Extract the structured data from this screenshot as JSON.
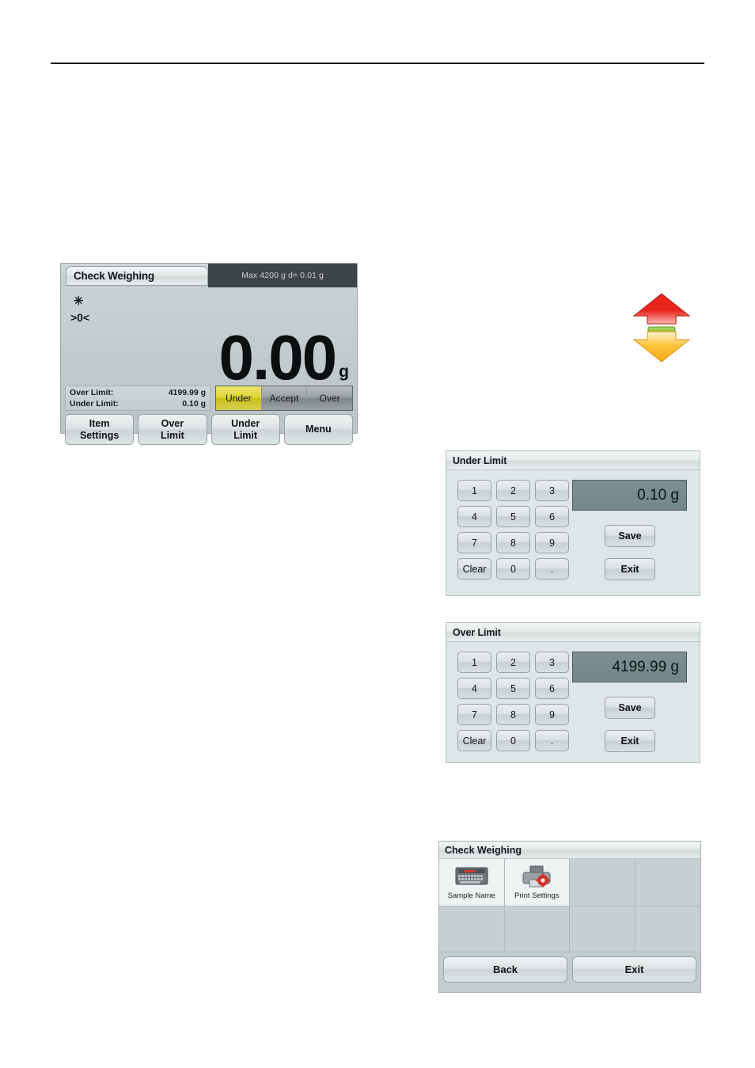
{
  "main_display": {
    "title": "Check Weighing",
    "capacity": "Max 4200 g   d= 0.01 g",
    "flag_stable": "✳",
    "flag_zero": ">0<",
    "weight_value": "0.00",
    "weight_unit": "g",
    "limits": [
      {
        "label": "Over Limit:",
        "value": "4199.99 g"
      },
      {
        "label": "Under Limit:",
        "value": "0.10 g"
      }
    ],
    "segments": [
      {
        "label": "Under",
        "state": "active"
      },
      {
        "label": "Accept",
        "state": "inactive"
      },
      {
        "label": "Over",
        "state": "inactive"
      }
    ],
    "buttons": [
      {
        "line1": "Item",
        "line2": "Settings"
      },
      {
        "line1": "Over",
        "line2": "Limit"
      },
      {
        "line1": "Under",
        "line2": "Limit"
      },
      {
        "line1": "Menu",
        "line2": ""
      }
    ]
  },
  "arrows_graphic": {
    "name": "check-weighing-indicator-arrows",
    "up_arrow_color": "#e2231a",
    "middle_bar_color": "#8cc63f",
    "down_arrow_color": "#fdb913"
  },
  "under_limit_panel": {
    "title": "Under Limit",
    "value": "0.10 g",
    "keys": [
      "1",
      "2",
      "3",
      "4",
      "5",
      "6",
      "7",
      "8",
      "9",
      "Clear",
      "0",
      "."
    ],
    "save_label": "Save",
    "exit_label": "Exit"
  },
  "over_limit_panel": {
    "title": "Over Limit",
    "value": "4199.99 g",
    "keys": [
      "1",
      "2",
      "3",
      "4",
      "5",
      "6",
      "7",
      "8",
      "9",
      "Clear",
      "0",
      "."
    ],
    "save_label": "Save",
    "exit_label": "Exit"
  },
  "check_weighing_menu": {
    "title": "Check Weighing",
    "tiles": [
      {
        "label": "Sample Name",
        "icon": "keyboard-icon",
        "filled": true
      },
      {
        "label": "Print Settings",
        "icon": "printer-settings-icon",
        "filled": true
      },
      {
        "label": "",
        "icon": "",
        "filled": false
      },
      {
        "label": "",
        "icon": "",
        "filled": false
      },
      {
        "label": "",
        "icon": "",
        "filled": false
      },
      {
        "label": "",
        "icon": "",
        "filled": false
      },
      {
        "label": "",
        "icon": "",
        "filled": false
      },
      {
        "label": "",
        "icon": "",
        "filled": false
      }
    ],
    "back_label": "Back",
    "exit_label": "Exit"
  }
}
